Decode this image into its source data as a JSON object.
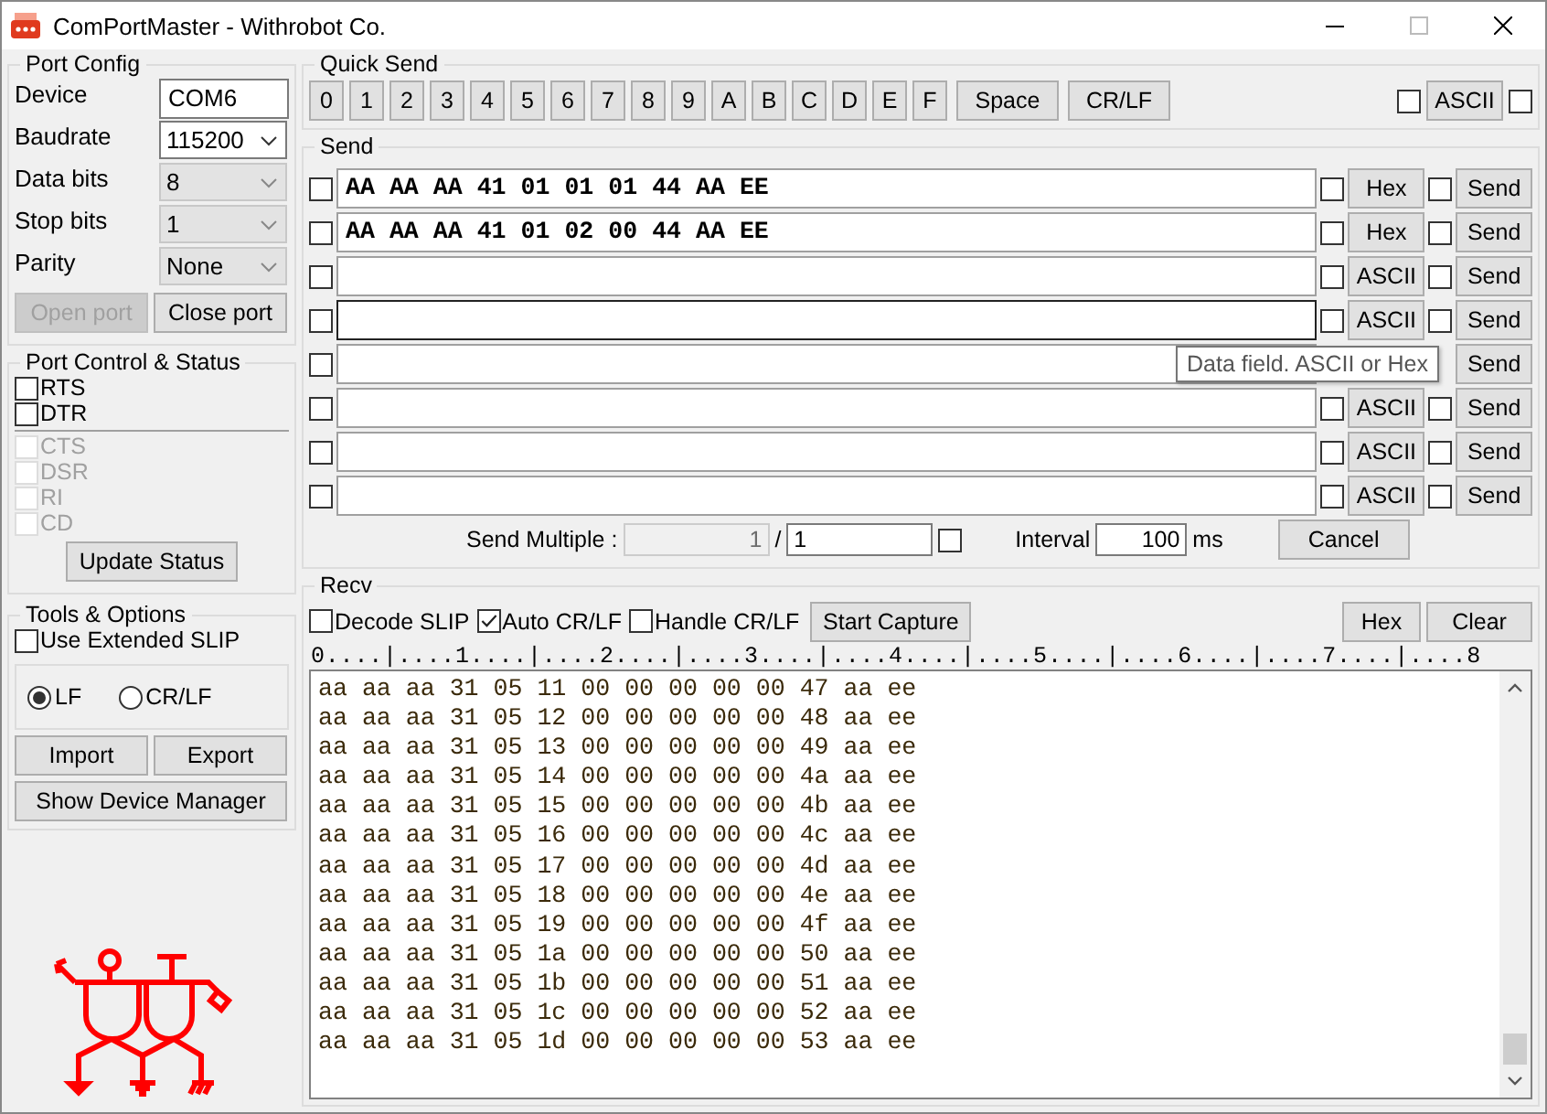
{
  "window": {
    "title": "ComPortMaster - Withrobot Co."
  },
  "port_config": {
    "title": "Port Config",
    "fields": [
      {
        "label": "Device",
        "value": "COM6",
        "kind": "text"
      },
      {
        "label": "Baudrate",
        "value": "115200",
        "kind": "dropdown",
        "disabled": false
      },
      {
        "label": "Data bits",
        "value": "8",
        "kind": "dropdown",
        "disabled": true
      },
      {
        "label": "Stop bits",
        "value": "1",
        "kind": "dropdown",
        "disabled": true
      },
      {
        "label": "Parity",
        "value": "None",
        "kind": "dropdown",
        "disabled": true
      }
    ],
    "buttons": [
      {
        "label": "Open port",
        "disabled": true
      },
      {
        "label": "Close port",
        "disabled": false
      }
    ]
  },
  "port_control": {
    "title": "Port Control & Status",
    "controls": [
      {
        "label": "RTS",
        "checked": false,
        "disabled": false
      },
      {
        "label": "DTR",
        "checked": false,
        "disabled": false
      }
    ],
    "status": [
      {
        "label": "CTS",
        "checked": false,
        "disabled": true
      },
      {
        "label": "DSR",
        "checked": false,
        "disabled": true
      },
      {
        "label": "RI",
        "checked": false,
        "disabled": true
      },
      {
        "label": "CD",
        "checked": false,
        "disabled": true
      }
    ],
    "button": "Update Status"
  },
  "tools": {
    "title": "Tools & Options",
    "option": {
      "label": "Use Extended SLIP",
      "checked": false
    },
    "line_endings": [
      {
        "label": "LF",
        "selected": true
      },
      {
        "label": "CR/LF",
        "selected": false
      }
    ],
    "buttons": [
      "Import",
      "Export",
      "Show Device Manager"
    ]
  },
  "quick_send": {
    "title": "Quick Send",
    "keys": [
      "0",
      "1",
      "2",
      "3",
      "4",
      "5",
      "6",
      "7",
      "8",
      "9",
      "A",
      "B",
      "C",
      "D",
      "E",
      "F",
      "Space",
      "CR/LF"
    ],
    "left_checked": false,
    "ascii_button": "ASCII",
    "right_checked": false
  },
  "send": {
    "title": "Send",
    "tooltip": "Data field. ASCII or Hex",
    "rows": [
      {
        "checked": false,
        "value": "AA AA AA 41 01 01 01 44 AA EE",
        "focused": false,
        "mode_checked": false,
        "mode": "Hex",
        "send_checked": false,
        "send": "Send"
      },
      {
        "checked": false,
        "value": "AA AA AA 41 01 02 00 44 AA EE",
        "focused": false,
        "mode_checked": false,
        "mode": "Hex",
        "send_checked": false,
        "send": "Send"
      },
      {
        "checked": false,
        "focused": false,
        "mode_checked": false,
        "mode": "ASCII",
        "send_checked": false,
        "send": "Send"
      },
      {
        "checked": false,
        "focused": true,
        "mode_checked": false,
        "mode": "ASCII",
        "send_checked": false,
        "send": "Send"
      },
      {
        "checked": false,
        "focused": false,
        "send": "Send"
      },
      {
        "checked": false,
        "focused": false,
        "mode_checked": false,
        "mode": "ASCII",
        "send_checked": false,
        "send": "Send"
      },
      {
        "checked": false,
        "focused": false,
        "mode_checked": false,
        "mode": "ASCII",
        "send_checked": false,
        "send": "Send"
      },
      {
        "checked": false,
        "focused": false,
        "mode_checked": false,
        "mode": "ASCII",
        "send_checked": false,
        "send": "Send"
      }
    ],
    "send_multiple": {
      "label": "Send Multiple :",
      "count": "1",
      "separator": "/",
      "total": "1",
      "checked": false,
      "interval_label": "Interval",
      "interval": "100",
      "unit": "ms",
      "cancel": "Cancel"
    }
  },
  "recv": {
    "title": "Recv",
    "options": [
      {
        "label": "Decode SLIP",
        "checked": false
      },
      {
        "label": "Auto CR/LF",
        "checked": true
      },
      {
        "label": "Handle CR/LF",
        "checked": false
      }
    ],
    "capture": "Start Capture",
    "buttons": [
      "Hex",
      "Clear"
    ],
    "ruler": "0....|....1....|....2....|....3....|....4....|....5....|....6....|....7....|....8",
    "lines": [
      "aa aa aa 31 05 11 00 00 00 00 00 47 aa ee",
      "aa aa aa 31 05 12 00 00 00 00 00 48 aa ee",
      "aa aa aa 31 05 13 00 00 00 00 00 49 aa ee",
      "aa aa aa 31 05 14 00 00 00 00 00 4a aa ee",
      "aa aa aa 31 05 15 00 00 00 00 00 4b aa ee",
      "aa aa aa 31 05 16 00 00 00 00 00 4c aa ee",
      "aa aa aa 31 05 17 00 00 00 00 00 4d aa ee",
      "aa aa aa 31 05 18 00 00 00 00 00 4e aa ee",
      "aa aa aa 31 05 19 00 00 00 00 00 4f aa ee",
      "aa aa aa 31 05 1a 00 00 00 00 00 50 aa ee",
      "aa aa aa 31 05 1b 00 00 00 00 00 51 aa ee",
      "aa aa aa 31 05 1c 00 00 00 00 00 52 aa ee",
      "aa aa aa 31 05 1d 00 00 00 00 00 53 aa ee"
    ]
  }
}
